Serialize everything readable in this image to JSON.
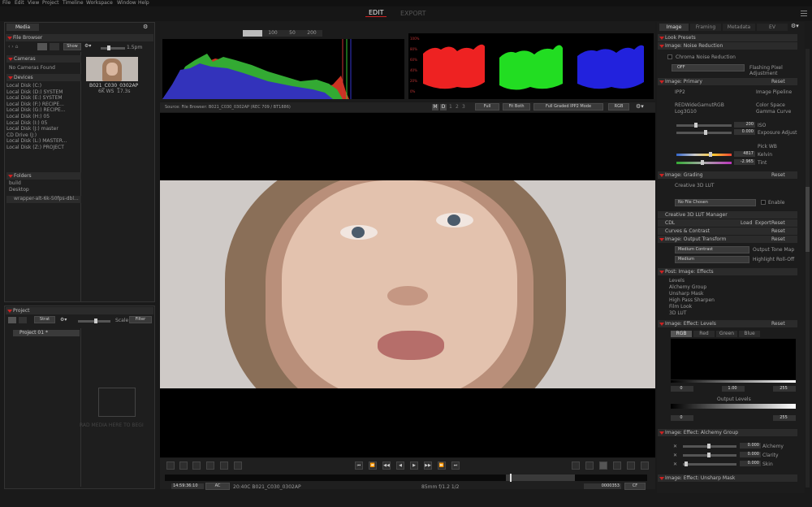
{
  "menu": [
    "File",
    "Edit",
    "View",
    "Project",
    "Timeline",
    "Workspace",
    "Window",
    "Help"
  ],
  "modes": {
    "edit": "EDIT",
    "export": "EXPORT"
  },
  "left": {
    "media_tab": "Media",
    "file_browser": "File Browser",
    "thumb_w": "1.5pm",
    "cameras": "Cameras",
    "no_cameras": "No Cameras Found",
    "devices": "Devices",
    "device_list": [
      "Local Disk (C:)",
      "Local Disk (D:) SYSTEM",
      "Local Disk (E:) SYSTEM",
      "Local Disk (F:) RECIPE...",
      "Local Disk (G:) RECIPE...",
      "Local Disk (H:) 05",
      "Local Disk (I:) 05",
      "Local Disk (J:) master",
      "CD Drive (J:)",
      "Local Disk (L:) MASTER...",
      "Local Disk (Z:) PROJECT"
    ],
    "folders": "Folders",
    "folder_list": [
      "build",
      "Desktop"
    ],
    "path": "wrapper-alt-6k-50fps-dbl...",
    "clip_name": "B021_C030_0302AP",
    "clip_res": "6K WS",
    "clip_fps": "17.3s",
    "show": "Show",
    "project": "Project",
    "proj_sort": "Strat",
    "proj_scale": "Scale",
    "proj_filter": "Filter",
    "proj_item": "Project 01 *",
    "drop_text": "RAD MEDIA HERE TO BEGI"
  },
  "scopes": {
    "tabs": [
      "",
      "100",
      "50",
      "200"
    ],
    "labels": [
      "100%",
      "80%",
      "60%",
      "40%",
      "20%",
      "0%"
    ]
  },
  "viewer": {
    "source": "Source: File Browser: B021_C030_0302AP   (REC 709 / BT1886)",
    "mode_btns": [
      "M",
      "D",
      "1",
      "2",
      "3"
    ],
    "full": "Full",
    "fitboth": "Fit Both",
    "ipp2": "Full Graded IPP2 Mode",
    "rgb": "RGB",
    "timecode": "14:59:36:10",
    "ac": "AC",
    "clip": "20:40C B021_C030_0302AP",
    "lens": "85mm  f/1.2  1/2",
    "frame": "0000353",
    "cf": "CF"
  },
  "right": {
    "tabs": [
      "Image",
      "Framing",
      "Metadata",
      "EV"
    ],
    "look_presets": "Look Presets",
    "noise": "Image: Noise Reduction",
    "chroma": "Chroma Noise Reduction",
    "off": "OFF",
    "flashing": "Flashing Pixel Adjustment",
    "primary": "Image: Primary",
    "reset": "Reset",
    "ipp2": "IPP2",
    "pipeline": "Image Pipeline",
    "cs": "REDWideGamutRGB",
    "cs_label": "Color Space",
    "gamma": "Log3G10",
    "gamma_label": "Gamma Curve",
    "iso": "200",
    "iso_label": "ISO",
    "exposure": "0.000",
    "exposure_label": "Exposure Adjust",
    "wb": "Pick WB",
    "kelvin": "4817",
    "kelvin_label": "Kelvin",
    "tint": "-2.965",
    "tint_label": "Tint",
    "grading": "Image: Grading",
    "c3d": "Creative 3D LUT",
    "no_file": "No File Chosen",
    "enable": "Enable",
    "c3d_mgr": "Creative 3D LUT Manager",
    "cdl": "CDL",
    "load": "Load",
    "export": "Export",
    "curves": "Curves & Contrast",
    "output": "Image: Output Transform",
    "medcontrast": "Medium Contrast",
    "tonemap": "Output Tone Map",
    "medium": "Medium",
    "rolloff": "Highlight Roll-Off",
    "post": "Post: Image: Effects",
    "effects": [
      "Levels",
      "Alchemy Group",
      "Unsharp Mask",
      "High Pass Sharpen",
      "Film Look",
      "3D LUT"
    ],
    "levels": "Image: Effect: Levels",
    "lv_tabs": [
      "RGB",
      "Red",
      "Green",
      "Blue"
    ],
    "lv_in": [
      "0",
      "1.00",
      "255"
    ],
    "output_levels": "Output Levels",
    "lv_out": [
      "0",
      "255"
    ],
    "alchemy": "Image: Effect: Alchemy Group",
    "alch": [
      {
        "v": "0.000",
        "l": "Alchemy"
      },
      {
        "v": "0.000",
        "l": "Clarity"
      },
      {
        "v": "0.000",
        "l": "Skin"
      }
    ],
    "unsharp": "Image: Effect: Unsharp Mask"
  }
}
